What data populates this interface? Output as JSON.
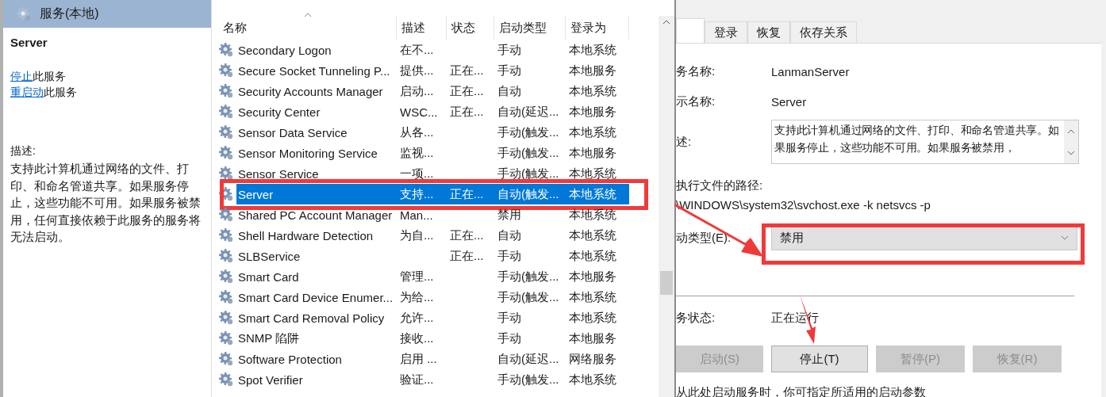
{
  "header": {
    "title": "服务(本地)"
  },
  "detail": {
    "service_name": "Server",
    "actions": [
      {
        "link": "停止",
        "text": "此服务"
      },
      {
        "link": "重启动",
        "text": "此服务"
      }
    ],
    "description_label": "描述:",
    "description": "支持此计算机通过网络的文件、打印、和命名管道共享。如果服务停止，这些功能不可用。如果服务被禁用，任何直接依赖于此服务的服务将无法启动。"
  },
  "table": {
    "columns": [
      {
        "label": "名称",
        "sorted": true
      },
      {
        "label": "描述",
        "sorted": false
      },
      {
        "label": "状态",
        "sorted": false
      },
      {
        "label": "启动类型",
        "sorted": false
      },
      {
        "label": "登录为",
        "sorted": false
      }
    ],
    "rows": [
      {
        "name": "Secondary Logon",
        "description": "在不...",
        "status": "",
        "startup_type": "手动",
        "log_on_as": "本地系统",
        "selected": false
      },
      {
        "name": "Secure Socket Tunneling P...",
        "description": "提供...",
        "status": "正在...",
        "startup_type": "手动",
        "log_on_as": "本地服务",
        "selected": false
      },
      {
        "name": "Security Accounts Manager",
        "description": "启动...",
        "status": "正在...",
        "startup_type": "自动",
        "log_on_as": "本地系统",
        "selected": false
      },
      {
        "name": "Security Center",
        "description": "WSC...",
        "status": "正在...",
        "startup_type": "自动(延迟...",
        "log_on_as": "本地服务",
        "selected": false
      },
      {
        "name": "Sensor Data Service",
        "description": "从各...",
        "status": "",
        "startup_type": "手动(触发...",
        "log_on_as": "本地系统",
        "selected": false
      },
      {
        "name": "Sensor Monitoring Service",
        "description": "监视...",
        "status": "",
        "startup_type": "手动(触发...",
        "log_on_as": "本地服务",
        "selected": false
      },
      {
        "name": "Sensor Service",
        "description": "一项...",
        "status": "",
        "startup_type": "手动(触发...",
        "log_on_as": "本地系统",
        "selected": false
      },
      {
        "name": "Server",
        "description": "支持...",
        "status": "正在...",
        "startup_type": "自动(触发...",
        "log_on_as": "本地系统",
        "selected": true
      },
      {
        "name": "Shared PC Account Manager",
        "description": "Man...",
        "status": "",
        "startup_type": "禁用",
        "log_on_as": "本地系统",
        "selected": false
      },
      {
        "name": "Shell Hardware Detection",
        "description": "为自...",
        "status": "正在...",
        "startup_type": "自动",
        "log_on_as": "本地系统",
        "selected": false
      },
      {
        "name": "SLBService",
        "description": "",
        "status": "正在...",
        "startup_type": "手动",
        "log_on_as": "本地系统",
        "selected": false
      },
      {
        "name": "Smart Card",
        "description": "管理...",
        "status": "",
        "startup_type": "手动(触发...",
        "log_on_as": "本地服务",
        "selected": false
      },
      {
        "name": "Smart Card Device Enumer...",
        "description": "为给...",
        "status": "",
        "startup_type": "手动(触发...",
        "log_on_as": "本地系统",
        "selected": false
      },
      {
        "name": "Smart Card Removal Policy",
        "description": "允许...",
        "status": "",
        "startup_type": "手动",
        "log_on_as": "本地系统",
        "selected": false
      },
      {
        "name": "SNMP 陷阱",
        "description": "接收...",
        "status": "",
        "startup_type": "手动",
        "log_on_as": "本地服务",
        "selected": false
      },
      {
        "name": "Software Protection",
        "description": "启用 ...",
        "status": "",
        "startup_type": "自动(延迟...",
        "log_on_as": "网络服务",
        "selected": false
      },
      {
        "name": "Spot Verifier",
        "description": "验证...",
        "status": "",
        "startup_type": "手动(触发...",
        "log_on_as": "本地系统",
        "selected": false
      }
    ]
  },
  "properties": {
    "tabs": [
      {
        "selected": true
      },
      {
        "label": "登录",
        "selected": false
      },
      {
        "label": "恢复",
        "selected": false
      },
      {
        "label": "依存关系",
        "selected": false
      }
    ],
    "service_name_label": "务名称:",
    "service_name": "LanmanServer",
    "display_name_label": "示名称:",
    "display_name": "Server",
    "description_label": "述:",
    "description": "支持此计算机通过网络的文件、打印、和命名管道共享。如果服务停止，这些功能不可用。如果服务被禁用，",
    "path_label": "执行文件的路径:",
    "path": "\\WINDOWS\\system32\\svchost.exe -k netsvcs -p",
    "startup_type_label": "动类型(E):",
    "startup_type": "禁用",
    "status_label": "务状态:",
    "status": "正在运行",
    "buttons": [
      {
        "label": "启动(S)",
        "disabled": true
      },
      {
        "label": "停止(T)",
        "disabled": false
      },
      {
        "label": "暂停(P)",
        "disabled": true
      },
      {
        "label": "恢复(R)",
        "disabled": true
      }
    ],
    "hint": "从此处启动服务时，你可指定所适用的启动参数"
  }
}
